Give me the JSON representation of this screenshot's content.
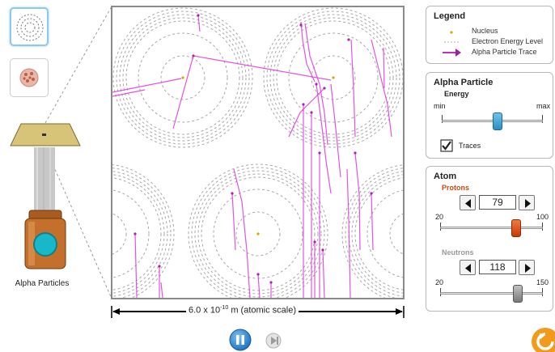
{
  "view_buttons": [
    {
      "name": "atom-view",
      "icon": "atom-rings-icon",
      "selected": true
    },
    {
      "name": "plum-pudding-view",
      "icon": "plum-pudding-icon",
      "selected": false
    }
  ],
  "gun": {
    "label": "Alpha Particles",
    "on": true
  },
  "scale": {
    "prefix": "6.0 x 10",
    "exponent": "-10",
    "suffix": " m (atomic scale)"
  },
  "legend": {
    "title": "Legend",
    "items": [
      {
        "label": "Nucleus",
        "icon": "nucleus-dot-icon"
      },
      {
        "label": "Electron Energy Level",
        "icon": "dashed-line-icon"
      },
      {
        "label": "Alpha Particle Trace",
        "icon": "arrow-trace-icon"
      }
    ]
  },
  "alpha_particle": {
    "title": "Alpha Particle",
    "energy_label": "Energy",
    "min_label": "min",
    "max_label": "max",
    "energy_fraction": 0.55,
    "traces_label": "Traces",
    "traces_checked": true
  },
  "atom": {
    "title": "Atom",
    "protons": {
      "label": "Protons",
      "value": "79",
      "min_label": "20",
      "max_label": "100",
      "fraction": 0.74
    },
    "neutrons": {
      "label": "Neutrons",
      "value": "118",
      "min_label": "20",
      "max_label": "150",
      "fraction": 0.754
    }
  },
  "controls": {
    "play_state": "playing",
    "pause_icon": "pause-icon",
    "step_icon": "step-icon",
    "reset_icon": "reset-icon"
  },
  "colors": {
    "trace": "#e040e0",
    "nucleus": "#d4a800",
    "accent": "#2a9fd6",
    "protons_thumb": "#e0501a",
    "neutrons_thumb": "#8a8a8a",
    "protons_label": "#d04a10",
    "panel_border": "#b8b8b8"
  }
}
